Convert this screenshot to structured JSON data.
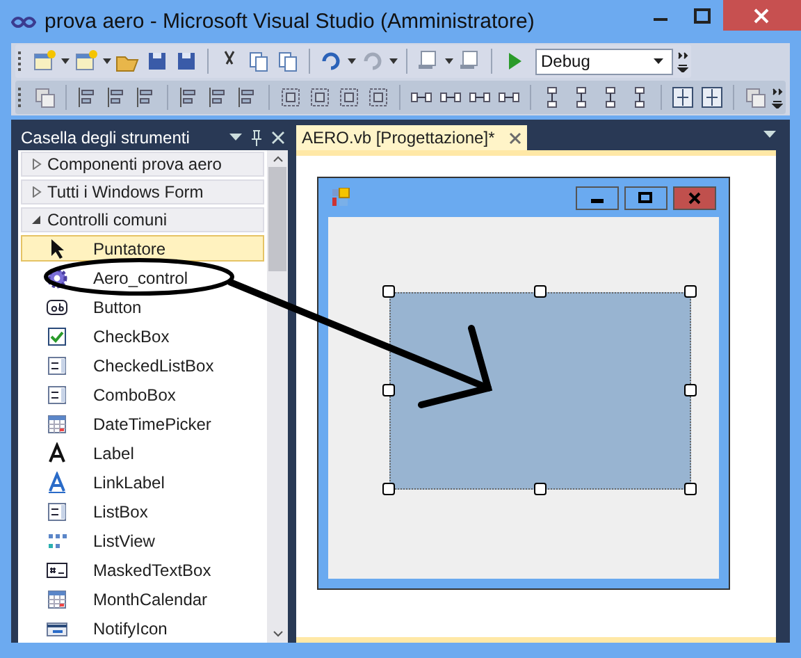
{
  "window": {
    "title": "prova aero - Microsoft Visual Studio (Amministratore)"
  },
  "toolbar": {
    "configuration": "Debug"
  },
  "toolbox": {
    "title": "Casella degli strumenti",
    "groups": [
      {
        "label": "Componenti prova aero",
        "expanded": false
      },
      {
        "label": "Tutti i Windows Form",
        "expanded": false
      },
      {
        "label": "Controlli comuni",
        "expanded": true,
        "items": [
          {
            "label": "Puntatore",
            "selected": true
          },
          {
            "label": "Aero_control",
            "selected": false
          },
          {
            "label": "Button",
            "selected": false
          },
          {
            "label": "CheckBox",
            "selected": false
          },
          {
            "label": "CheckedListBox",
            "selected": false
          },
          {
            "label": "ComboBox",
            "selected": false
          },
          {
            "label": "DateTimePicker",
            "selected": false
          },
          {
            "label": "Label",
            "selected": false
          },
          {
            "label": "LinkLabel",
            "selected": false
          },
          {
            "label": "ListBox",
            "selected": false
          },
          {
            "label": "ListView",
            "selected": false
          },
          {
            "label": "MaskedTextBox",
            "selected": false
          },
          {
            "label": "MonthCalendar",
            "selected": false
          },
          {
            "label": "NotifyIcon",
            "selected": false
          }
        ]
      }
    ]
  },
  "document_tabs": [
    {
      "label": "AERO.vb [Progettazione]*",
      "selected": true
    }
  ]
}
